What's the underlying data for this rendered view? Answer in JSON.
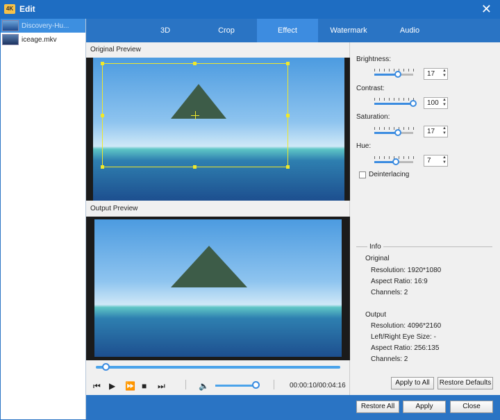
{
  "window": {
    "title": "Edit",
    "app_icon_text": "4K"
  },
  "files": [
    {
      "name": "Discovery-Hu..."
    },
    {
      "name": "iceage.mkv"
    }
  ],
  "tabs": [
    "3D",
    "Crop",
    "Effect",
    "Watermark",
    "Audio"
  ],
  "active_tab": "Effect",
  "preview": {
    "original_label": "Original Preview",
    "output_label": "Output Preview",
    "time": "00:00:10/00:04:16",
    "progress_fraction": 0.04,
    "volume_fraction": 0.95
  },
  "effects": {
    "brightness": {
      "label": "Brightness:",
      "value": "17",
      "fraction": 0.6
    },
    "contrast": {
      "label": "Contrast:",
      "value": "100",
      "fraction": 1.0
    },
    "saturation": {
      "label": "Saturation:",
      "value": "17",
      "fraction": 0.6
    },
    "hue": {
      "label": "Hue:",
      "value": "7",
      "fraction": 0.55
    },
    "deinterlacing_label": "Deinterlacing",
    "deinterlacing_checked": false
  },
  "info": {
    "title": "Info",
    "original_heading": "Original",
    "original_resolution": "Resolution: 1920*1080",
    "original_aspect": "Aspect Ratio: 16:9",
    "original_channels": "Channels: 2",
    "output_heading": "Output",
    "output_resolution": "Resolution: 4096*2160",
    "output_eye": "Left/Right Eye Size: -",
    "output_aspect": "Aspect Ratio: 256:135",
    "output_channels": "Channels: 2"
  },
  "buttons": {
    "apply_to_all": "Apply to All",
    "restore_defaults": "Restore Defaults",
    "restore_all": "Restore All",
    "apply": "Apply",
    "close": "Close"
  },
  "colors": {
    "accent": "#2a74c4",
    "crop_frame": "#f0e82a"
  }
}
